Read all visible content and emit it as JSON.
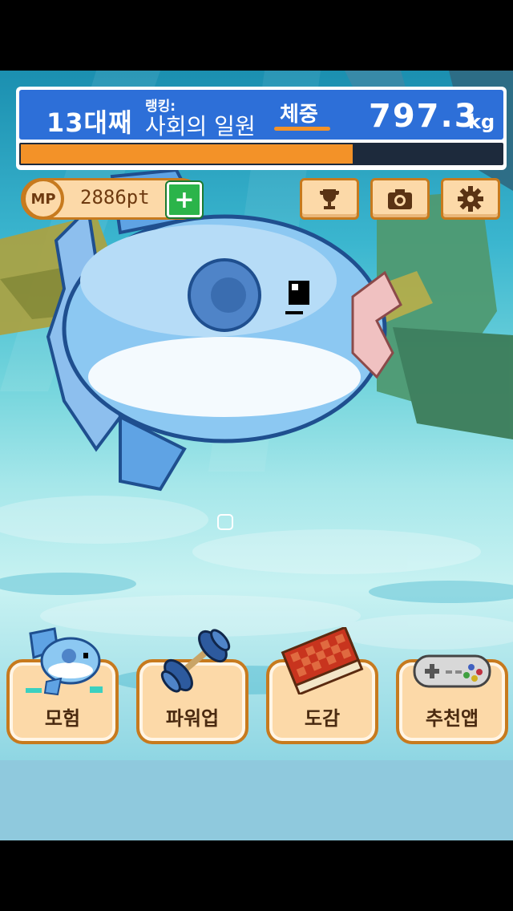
{
  "status": {
    "generation": "13대째",
    "rank_label": "랭킹:",
    "rank_value": "사회의 일원",
    "weight_label": "체중",
    "weight_value": "797.3",
    "weight_unit": "kg",
    "progress_fraction": 0.69
  },
  "mp": {
    "badge": "MP",
    "points": "2886pt",
    "plus": "+"
  },
  "toolbar": {
    "icons": [
      "trophy-icon",
      "camera-icon",
      "gear-icon"
    ]
  },
  "menu": [
    {
      "label": "모험",
      "icon": "sunfish-icon"
    },
    {
      "label": "파워업",
      "icon": "dumbbell-icon"
    },
    {
      "label": "도감",
      "icon": "book-icon"
    },
    {
      "label": "추천앱",
      "icon": "gamepad-icon"
    }
  ],
  "colors": {
    "panel_blue": "#2d6fd8",
    "progress_orange": "#f39228",
    "button_fill": "#fcd9a8",
    "button_border": "#c77a1e",
    "plus_green": "#2bb44a"
  }
}
